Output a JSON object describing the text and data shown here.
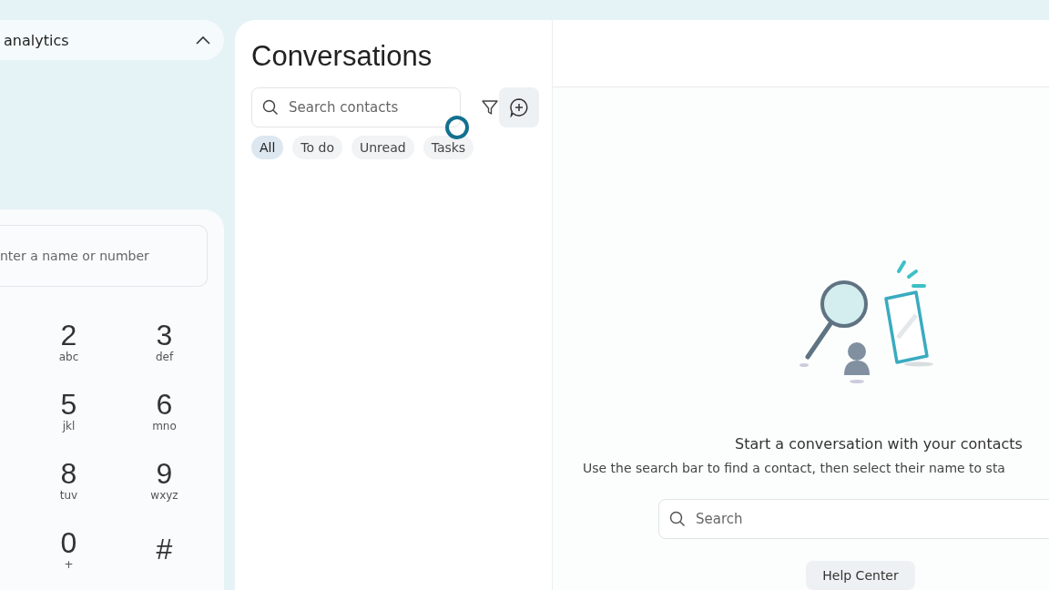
{
  "sidebar": {
    "section": {
      "title": "analytics",
      "expanded": true
    },
    "dialer": {
      "placeholder": "nter a name or number",
      "keys": [
        {
          "digit": "2",
          "letters": "abc"
        },
        {
          "digit": "3",
          "letters": "def"
        },
        {
          "digit": "5",
          "letters": "jkl"
        },
        {
          "digit": "6",
          "letters": "mno"
        },
        {
          "digit": "8",
          "letters": "tuv"
        },
        {
          "digit": "9",
          "letters": "wxyz"
        },
        {
          "digit": "0",
          "letters": "+"
        },
        {
          "digit": "#"
        }
      ]
    }
  },
  "conversations": {
    "title": "Conversations",
    "search": {
      "placeholder": "Search contacts"
    },
    "filters": [
      {
        "label": "All",
        "selected": true
      },
      {
        "label": "To do",
        "selected": false
      },
      {
        "label": "Unread",
        "selected": false
      },
      {
        "label": "Tasks",
        "selected": false
      }
    ]
  },
  "empty_state": {
    "heading": "Start a conversation with your contacts",
    "text": "Use the search bar to find a contact, then select their name to sta",
    "search": {
      "placeholder": "Search"
    },
    "button": "Help Center"
  }
}
